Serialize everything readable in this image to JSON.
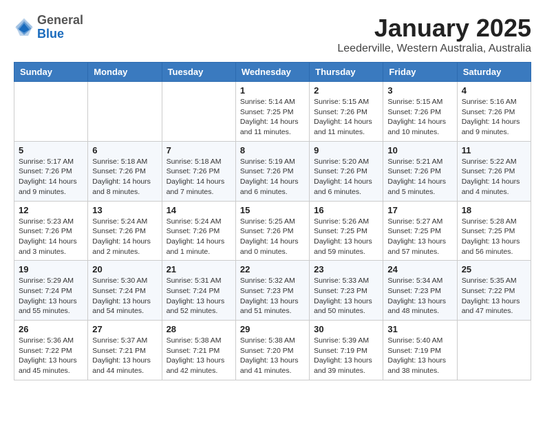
{
  "header": {
    "logo_general": "General",
    "logo_blue": "Blue",
    "month_title": "January 2025",
    "location": "Leederville, Western Australia, Australia"
  },
  "days_of_week": [
    "Sunday",
    "Monday",
    "Tuesday",
    "Wednesday",
    "Thursday",
    "Friday",
    "Saturday"
  ],
  "weeks": [
    [
      {
        "day": "",
        "info": ""
      },
      {
        "day": "",
        "info": ""
      },
      {
        "day": "",
        "info": ""
      },
      {
        "day": "1",
        "info": "Sunrise: 5:14 AM\nSunset: 7:25 PM\nDaylight: 14 hours\nand 11 minutes."
      },
      {
        "day": "2",
        "info": "Sunrise: 5:15 AM\nSunset: 7:26 PM\nDaylight: 14 hours\nand 11 minutes."
      },
      {
        "day": "3",
        "info": "Sunrise: 5:15 AM\nSunset: 7:26 PM\nDaylight: 14 hours\nand 10 minutes."
      },
      {
        "day": "4",
        "info": "Sunrise: 5:16 AM\nSunset: 7:26 PM\nDaylight: 14 hours\nand 9 minutes."
      }
    ],
    [
      {
        "day": "5",
        "info": "Sunrise: 5:17 AM\nSunset: 7:26 PM\nDaylight: 14 hours\nand 9 minutes."
      },
      {
        "day": "6",
        "info": "Sunrise: 5:18 AM\nSunset: 7:26 PM\nDaylight: 14 hours\nand 8 minutes."
      },
      {
        "day": "7",
        "info": "Sunrise: 5:18 AM\nSunset: 7:26 PM\nDaylight: 14 hours\nand 7 minutes."
      },
      {
        "day": "8",
        "info": "Sunrise: 5:19 AM\nSunset: 7:26 PM\nDaylight: 14 hours\nand 6 minutes."
      },
      {
        "day": "9",
        "info": "Sunrise: 5:20 AM\nSunset: 7:26 PM\nDaylight: 14 hours\nand 6 minutes."
      },
      {
        "day": "10",
        "info": "Sunrise: 5:21 AM\nSunset: 7:26 PM\nDaylight: 14 hours\nand 5 minutes."
      },
      {
        "day": "11",
        "info": "Sunrise: 5:22 AM\nSunset: 7:26 PM\nDaylight: 14 hours\nand 4 minutes."
      }
    ],
    [
      {
        "day": "12",
        "info": "Sunrise: 5:23 AM\nSunset: 7:26 PM\nDaylight: 14 hours\nand 3 minutes."
      },
      {
        "day": "13",
        "info": "Sunrise: 5:24 AM\nSunset: 7:26 PM\nDaylight: 14 hours\nand 2 minutes."
      },
      {
        "day": "14",
        "info": "Sunrise: 5:24 AM\nSunset: 7:26 PM\nDaylight: 14 hours\nand 1 minute."
      },
      {
        "day": "15",
        "info": "Sunrise: 5:25 AM\nSunset: 7:26 PM\nDaylight: 14 hours\nand 0 minutes."
      },
      {
        "day": "16",
        "info": "Sunrise: 5:26 AM\nSunset: 7:25 PM\nDaylight: 13 hours\nand 59 minutes."
      },
      {
        "day": "17",
        "info": "Sunrise: 5:27 AM\nSunset: 7:25 PM\nDaylight: 13 hours\nand 57 minutes."
      },
      {
        "day": "18",
        "info": "Sunrise: 5:28 AM\nSunset: 7:25 PM\nDaylight: 13 hours\nand 56 minutes."
      }
    ],
    [
      {
        "day": "19",
        "info": "Sunrise: 5:29 AM\nSunset: 7:24 PM\nDaylight: 13 hours\nand 55 minutes."
      },
      {
        "day": "20",
        "info": "Sunrise: 5:30 AM\nSunset: 7:24 PM\nDaylight: 13 hours\nand 54 minutes."
      },
      {
        "day": "21",
        "info": "Sunrise: 5:31 AM\nSunset: 7:24 PM\nDaylight: 13 hours\nand 52 minutes."
      },
      {
        "day": "22",
        "info": "Sunrise: 5:32 AM\nSunset: 7:23 PM\nDaylight: 13 hours\nand 51 minutes."
      },
      {
        "day": "23",
        "info": "Sunrise: 5:33 AM\nSunset: 7:23 PM\nDaylight: 13 hours\nand 50 minutes."
      },
      {
        "day": "24",
        "info": "Sunrise: 5:34 AM\nSunset: 7:23 PM\nDaylight: 13 hours\nand 48 minutes."
      },
      {
        "day": "25",
        "info": "Sunrise: 5:35 AM\nSunset: 7:22 PM\nDaylight: 13 hours\nand 47 minutes."
      }
    ],
    [
      {
        "day": "26",
        "info": "Sunrise: 5:36 AM\nSunset: 7:22 PM\nDaylight: 13 hours\nand 45 minutes."
      },
      {
        "day": "27",
        "info": "Sunrise: 5:37 AM\nSunset: 7:21 PM\nDaylight: 13 hours\nand 44 minutes."
      },
      {
        "day": "28",
        "info": "Sunrise: 5:38 AM\nSunset: 7:21 PM\nDaylight: 13 hours\nand 42 minutes."
      },
      {
        "day": "29",
        "info": "Sunrise: 5:38 AM\nSunset: 7:20 PM\nDaylight: 13 hours\nand 41 minutes."
      },
      {
        "day": "30",
        "info": "Sunrise: 5:39 AM\nSunset: 7:19 PM\nDaylight: 13 hours\nand 39 minutes."
      },
      {
        "day": "31",
        "info": "Sunrise: 5:40 AM\nSunset: 7:19 PM\nDaylight: 13 hours\nand 38 minutes."
      },
      {
        "day": "",
        "info": ""
      }
    ]
  ]
}
